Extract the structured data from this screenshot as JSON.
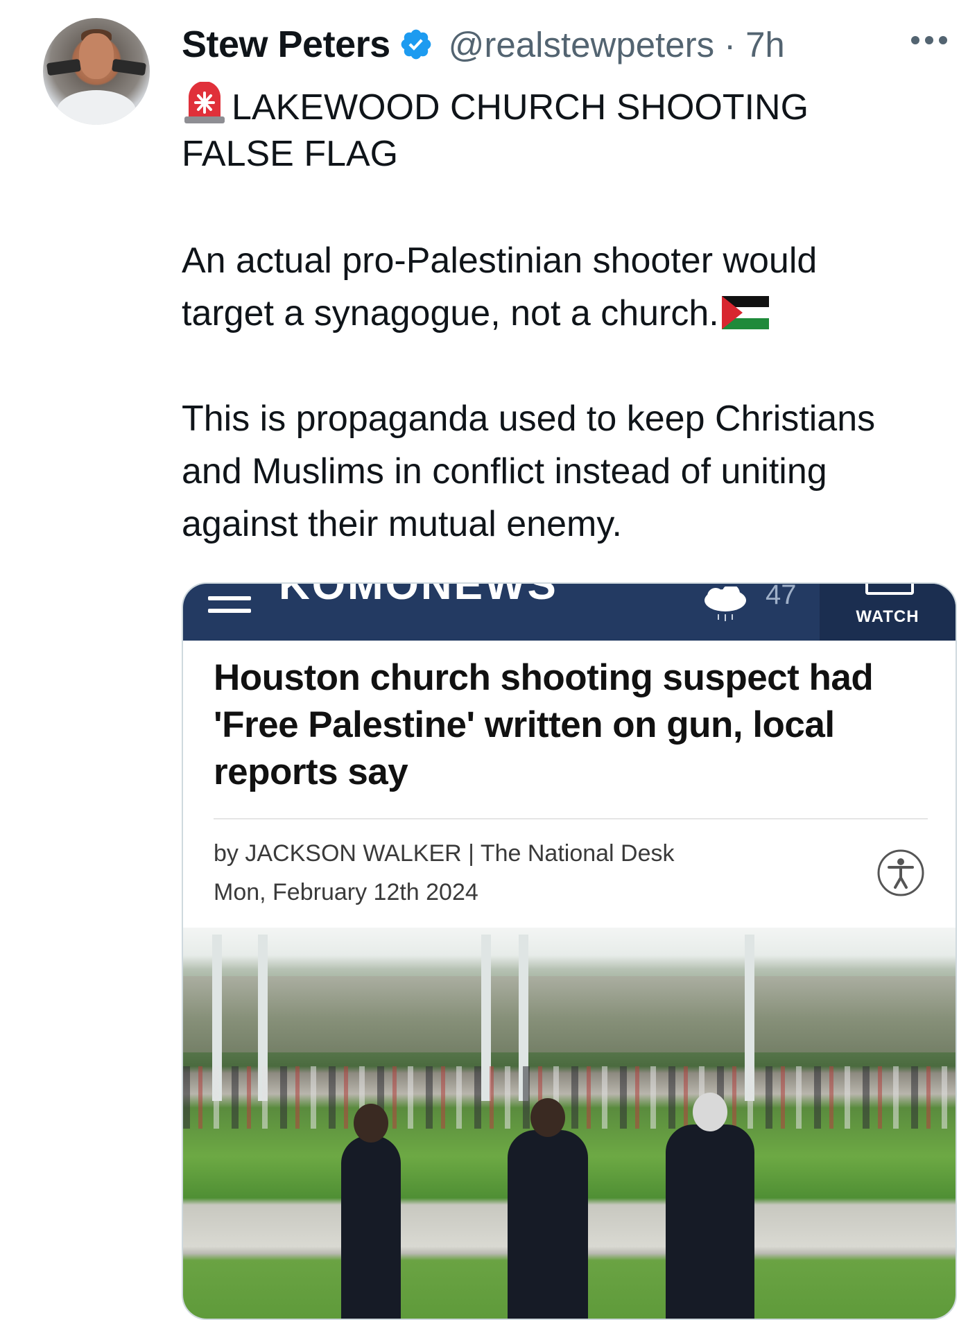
{
  "tweet": {
    "author_name": "Stew Peters",
    "handle": "@realstewpeters",
    "separator": "·",
    "time": "7h",
    "lines": {
      "l1": "LAKEWOOD CHURCH SHOOTING",
      "l2": "FALSE FLAG",
      "l3": "An actual pro-Palestinian shooter would",
      "l4": "target a synagogue, not a church.",
      "l5": "This is propaganda used to keep Christians",
      "l6": "and Muslims in conflict instead of uniting",
      "l7": "against their mutual enemy."
    },
    "icons": [
      "verified-badge-icon",
      "more-options-icon",
      "siren-emoji-icon",
      "palestine-flag-emoji-icon"
    ],
    "colors": {
      "verified_blue": "#1d9bf0",
      "secondary_text": "#536471",
      "card_border": "#cfd9de"
    }
  },
  "article_card": {
    "site_logo": "KOMONEWS",
    "temperature": "47",
    "watch_label": "WATCH",
    "headline": "Houston church shooting suspect had 'Free Palestine' written on gun, local reports say",
    "byline": "by JACKSON WALKER | The National Desk",
    "date": "Mon, February 12th 2024",
    "icons": [
      "menu-icon",
      "rain-cloud-icon",
      "tv-icon",
      "accessibility-icon"
    ],
    "colors": {
      "navbar": "#233a62",
      "watch_box": "#1b2e50"
    }
  }
}
